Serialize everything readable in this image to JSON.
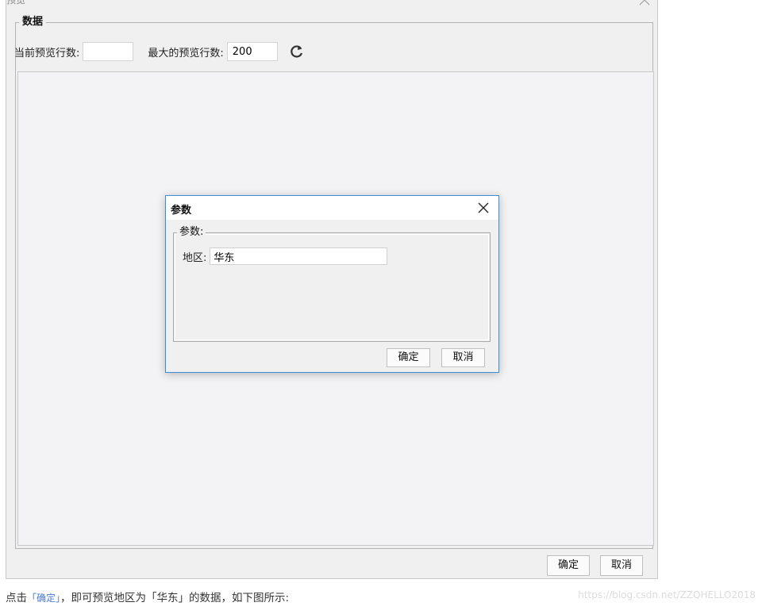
{
  "window": {
    "title": "预览",
    "group_label": "数据",
    "current_rows_label": "当前预览行数:",
    "current_rows_value": "",
    "max_rows_label": "最大的预览行数:",
    "max_rows_value": "200",
    "ok_label": "确定",
    "cancel_label": "取消"
  },
  "dialog": {
    "title": "参数",
    "group_label": "参数:",
    "param_label": "地区:",
    "param_value": "华东",
    "ok_label": "确定",
    "cancel_label": "取消"
  },
  "caption": {
    "prefix": "点击",
    "highlight": "「确定」",
    "suffix": "，即可预览地区为「华东」的数据，如下图所示:"
  },
  "watermark": "https://blog.csdn.net/ZZQHELLO2018",
  "icons": [
    "close-icon",
    "refresh-icon"
  ]
}
